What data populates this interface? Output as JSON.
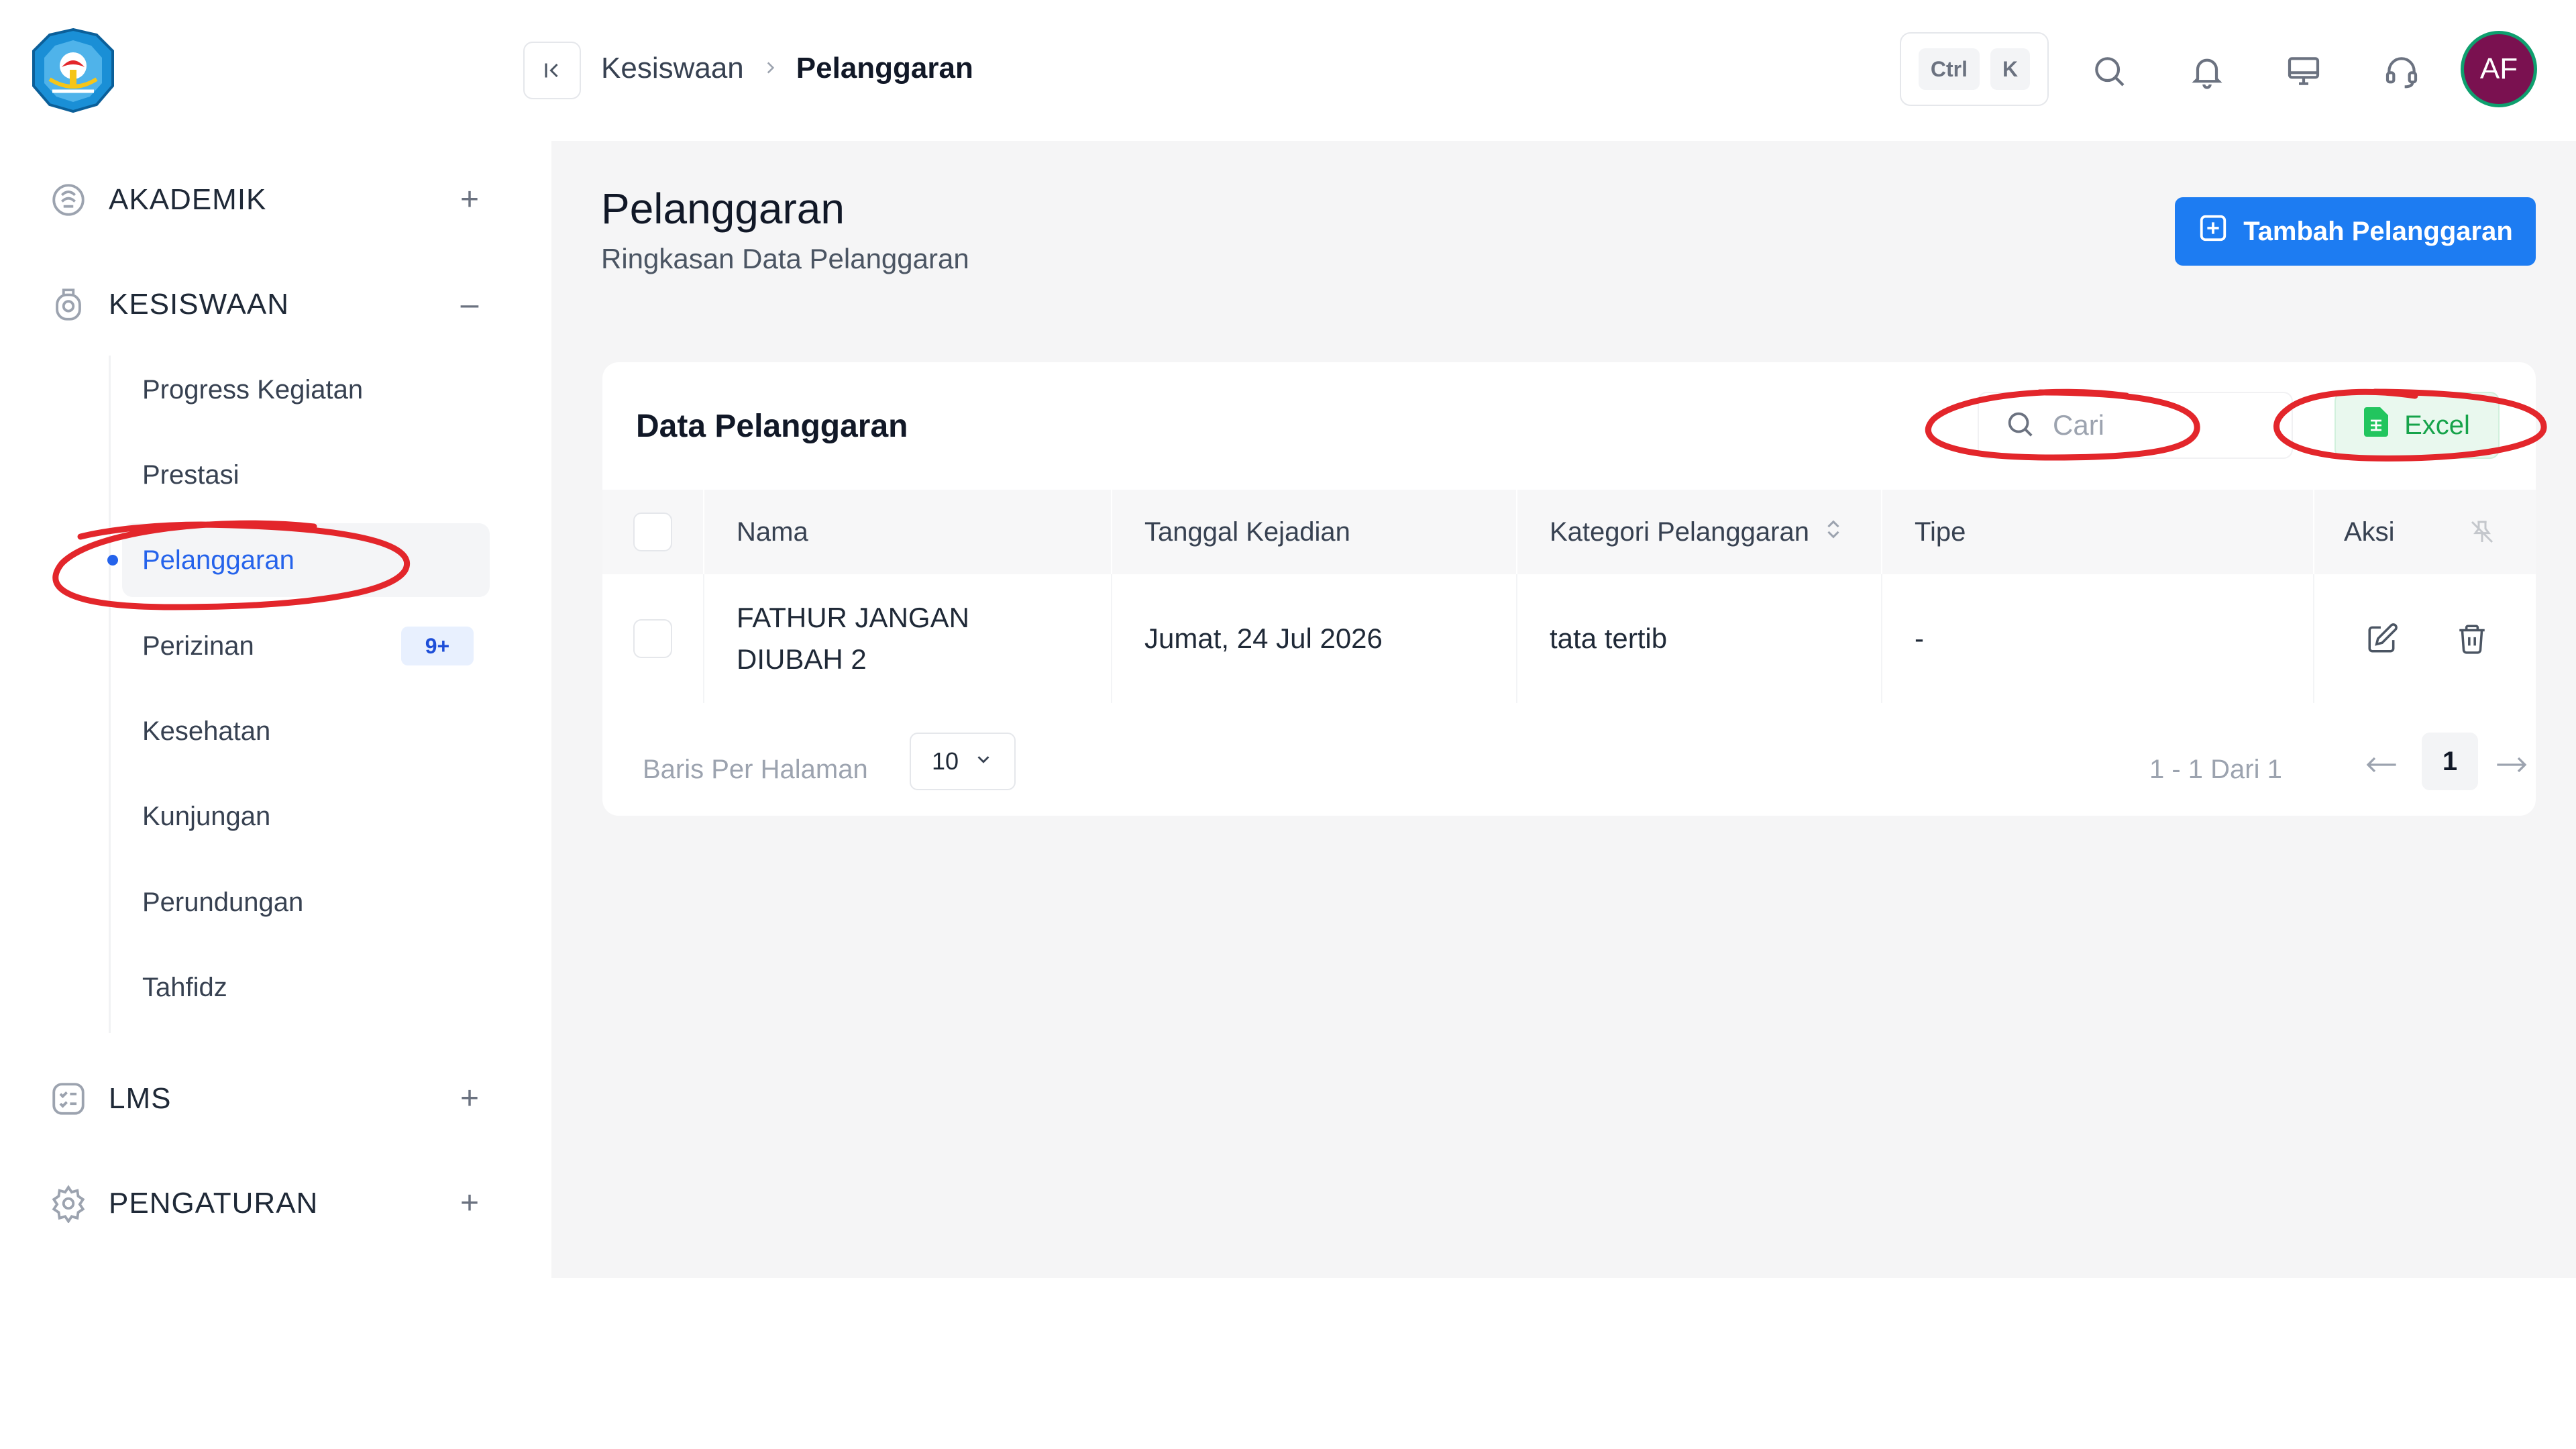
{
  "colors": {
    "primary": "#1d7cf2",
    "active_text": "#2563eb",
    "excel_green": "#16a34a",
    "avatar_bg": "#7a1150",
    "avatar_ring": "#0e9f6e",
    "annotation_red": "#e3262b"
  },
  "sidebar": {
    "groups": {
      "akademik": {
        "label": "AKADEMIK",
        "icon": "academic-icon",
        "toggle": "+"
      },
      "kesiswaan": {
        "label": "KESISWAAN",
        "icon": "student-icon",
        "toggle": "–"
      },
      "lms": {
        "label": "LMS",
        "icon": "checklist-icon",
        "toggle": "+"
      },
      "pengaturan": {
        "label": "PENGATURAN",
        "icon": "gear-icon",
        "toggle": "+"
      }
    },
    "items": [
      {
        "label": "Progress Kegiatan"
      },
      {
        "label": "Prestasi"
      },
      {
        "label": "Pelanggaran",
        "active": true
      },
      {
        "label": "Perizinan",
        "badge": "9+"
      },
      {
        "label": "Kesehatan"
      },
      {
        "label": "Kunjungan"
      },
      {
        "label": "Perundungan"
      },
      {
        "label": "Tahfidz"
      }
    ]
  },
  "header": {
    "breadcrumb": [
      "Kesiswaan",
      "Pelanggaran"
    ],
    "shortcut": [
      "Ctrl",
      "K"
    ],
    "icons": [
      "search-icon",
      "bell-icon",
      "monitor-icon",
      "headset-icon"
    ],
    "avatar_initials": "AF"
  },
  "page": {
    "title": "Pelanggaran",
    "subtitle": "Ringkasan Data Pelanggaran",
    "add_button": "Tambah Pelanggaran"
  },
  "table_card": {
    "title": "Data Pelanggaran",
    "search_placeholder": "Cari",
    "excel_button": "Excel",
    "columns": [
      "Nama",
      "Tanggal Kejadian",
      "Kategori Pelanggaran",
      "Tipe",
      "Aksi"
    ],
    "rows": [
      {
        "name_line1": "FATHUR JANGAN",
        "name_line2": "DIUBAH 2",
        "tanggal": "Jumat, 24 Jul 2026",
        "kategori": "tata tertib",
        "tipe": "-"
      }
    ],
    "footer": {
      "rows_per_page_label": "Baris Per Halaman",
      "rows_per_page_value": "10",
      "page_info": "1 - 1 Dari 1",
      "current_page": "1"
    }
  }
}
